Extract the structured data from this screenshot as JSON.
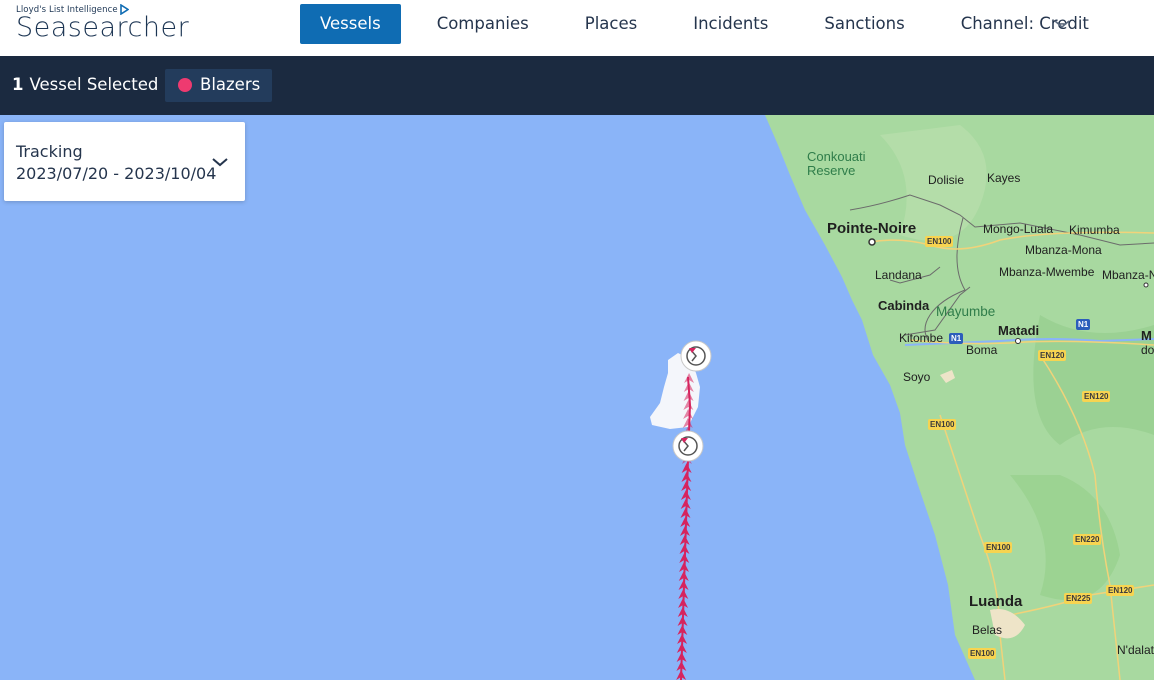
{
  "brand": {
    "company": "Lloyd's List Intelligence",
    "product": "Seasearcher"
  },
  "nav": {
    "items": [
      {
        "label": "Vessels",
        "active": true
      },
      {
        "label": "Companies",
        "active": false
      },
      {
        "label": "Places",
        "active": false
      },
      {
        "label": "Incidents",
        "active": false
      },
      {
        "label": "Sanctions",
        "active": false
      }
    ],
    "channel": "Channel: Credit",
    "menu_icon": "chevron-down-icon"
  },
  "selection": {
    "count": "1",
    "label": "Vessel Selected",
    "vessel_name": "Blazers",
    "vessel_color": "#ee3a70"
  },
  "tracking": {
    "title": "Tracking",
    "date_range": "2023/07/20 - 2023/10/04",
    "dropdown_icon": "chevron-down-icon"
  },
  "map": {
    "ocean_color": "#8ab4f8",
    "land_color": "#a8d9a0",
    "track_color": "#d6245e",
    "places": [
      {
        "name": "Conkouati\nReserve",
        "type": "park"
      },
      {
        "name": "Dolisie",
        "type": "city"
      },
      {
        "name": "Kayes",
        "type": "city"
      },
      {
        "name": "Pointe-Noire",
        "type": "major-city"
      },
      {
        "name": "Mongo-Luala",
        "type": "city"
      },
      {
        "name": "Kimumba",
        "type": "city"
      },
      {
        "name": "Mbanza-Mona",
        "type": "city"
      },
      {
        "name": "Landana",
        "type": "city"
      },
      {
        "name": "Mbanza-Mwembe",
        "type": "city"
      },
      {
        "name": "Mbanza-N",
        "type": "city"
      },
      {
        "name": "Cabinda",
        "type": "city"
      },
      {
        "name": "Mayumbe",
        "type": "region"
      },
      {
        "name": "Matadi",
        "type": "city"
      },
      {
        "name": "Kitombe",
        "type": "city"
      },
      {
        "name": "Boma",
        "type": "city"
      },
      {
        "name": "M",
        "type": "city"
      },
      {
        "name": "do",
        "type": "city"
      },
      {
        "name": "Soyo",
        "type": "city"
      },
      {
        "name": "Luanda",
        "type": "major-city"
      },
      {
        "name": "Belas",
        "type": "city"
      },
      {
        "name": "N'dalat",
        "type": "city"
      }
    ],
    "roads": [
      "EN100",
      "N1",
      "N1",
      "EN120",
      "EN120",
      "EN100",
      "EN100",
      "EN220",
      "EN225",
      "EN120",
      "EN100"
    ],
    "event_markers": [
      "vessel-event-icon",
      "vessel-event-icon"
    ]
  }
}
